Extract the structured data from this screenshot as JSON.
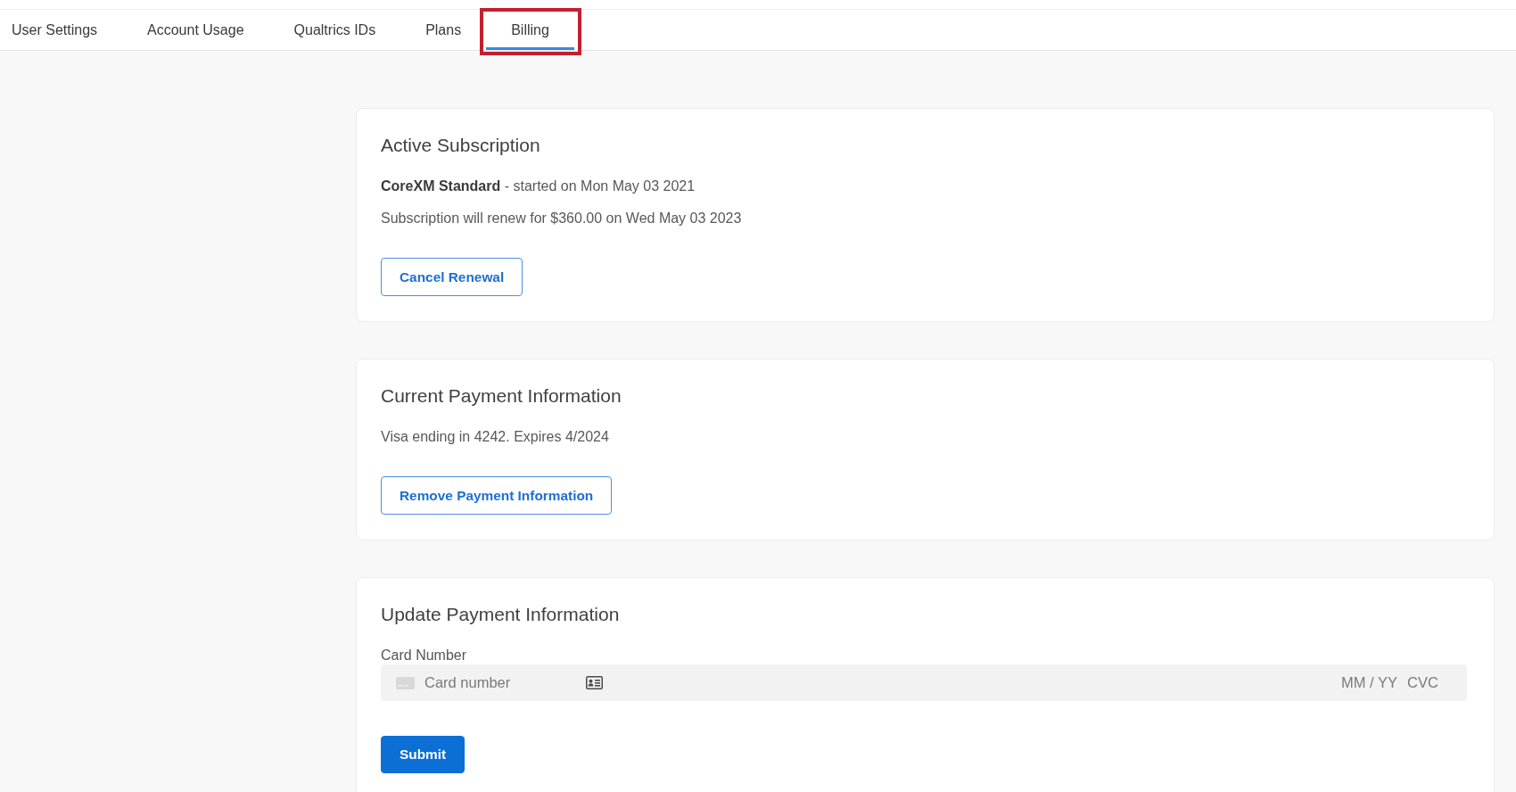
{
  "tabs": [
    {
      "label": "User Settings",
      "selected": false,
      "highlighted": false
    },
    {
      "label": "Account Usage",
      "selected": false,
      "highlighted": false
    },
    {
      "label": "Qualtrics IDs",
      "selected": false,
      "highlighted": false
    },
    {
      "label": "Plans",
      "selected": false,
      "highlighted": false
    },
    {
      "label": "Billing",
      "selected": true,
      "highlighted": true
    }
  ],
  "cards": [
    {
      "title": "Active Subscription",
      "lines": [
        "**CoreXM Standard** - started on Mon May 03 2021",
        "Subscription will renew for $360.00 on Wed May 03 2023"
      ],
      "button": {
        "label": "Cancel Renewal",
        "kind": "secondary"
      }
    },
    {
      "title": "Current Payment Information",
      "lines": [
        "Visa ending in 4242. Expires 4/2024"
      ],
      "button": {
        "label": "Remove Payment Information",
        "kind": "secondary"
      }
    },
    {
      "title": "Update Payment Information",
      "field": {
        "label": "Card Number",
        "card_number": {
          "placeholder": "Card number"
        },
        "expiry": {
          "placeholder": "MM / YY"
        },
        "cvc": {
          "placeholder": "CVC"
        }
      },
      "button": {
        "label": "Submit",
        "kind": "primary"
      }
    }
  ]
}
